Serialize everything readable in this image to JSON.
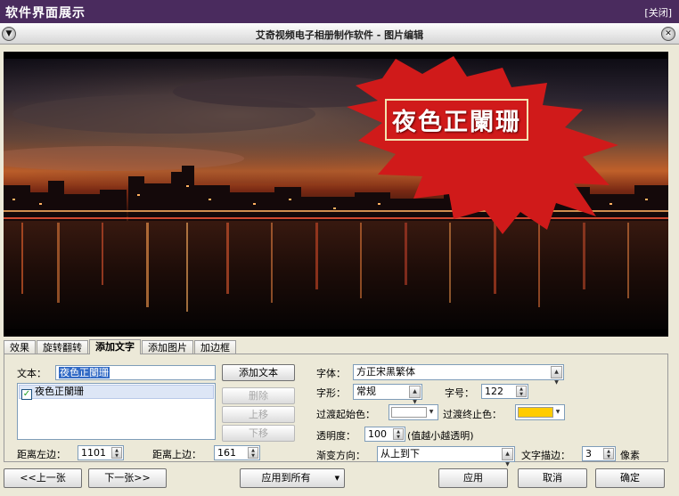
{
  "outer": {
    "title": "软件界面展示",
    "close": "[关闭]"
  },
  "window": {
    "title": "艾奇视频电子相册制作软件 - 图片编辑"
  },
  "preview": {
    "overlay_text": "夜色正闌珊"
  },
  "tabs": [
    {
      "label": "效果",
      "active": false
    },
    {
      "label": "旋转翻转",
      "active": false
    },
    {
      "label": "添加文字",
      "active": true
    },
    {
      "label": "添加图片",
      "active": false
    },
    {
      "label": "加边框",
      "active": false
    }
  ],
  "text_panel": {
    "text_label": "文本：",
    "text_value": "夜色正闌珊",
    "add_text_button": "添加文本",
    "list_items": [
      "夜色正闌珊"
    ],
    "delete_button": "删除",
    "up_button": "上移",
    "down_button": "下移",
    "left_distance_label": "距离左边：",
    "left_distance_value": "1101",
    "top_distance_label": "距离上边：",
    "top_distance_value": "161"
  },
  "font_panel": {
    "font_label": "字体：",
    "font_value": "方正宋黑繁体",
    "style_label": "字形：",
    "style_value": "常规",
    "size_label": "字号：",
    "size_value": "122",
    "gradient_start_label": "过渡起始色：",
    "gradient_start_color": "#ffffff",
    "gradient_end_label": "过渡终止色：",
    "gradient_end_color": "#ffcc00",
    "opacity_label": "透明度：",
    "opacity_value": "100",
    "opacity_hint": "(值越小越透明)",
    "direction_label": "渐变方向：",
    "direction_value": "从上到下",
    "stroke_label": "文字描边：",
    "stroke_value": "3",
    "stroke_unit": "像素"
  },
  "footer": {
    "prev_button": "<<上一张",
    "next_button": "下一张>>",
    "apply_all_button": "应用到所有",
    "apply_button": "应用",
    "cancel_button": "取消",
    "ok_button": "确定"
  },
  "icons": {
    "menu": "chevron-down-icon",
    "close": "close-icon",
    "check": "checkbox-checked-icon"
  }
}
